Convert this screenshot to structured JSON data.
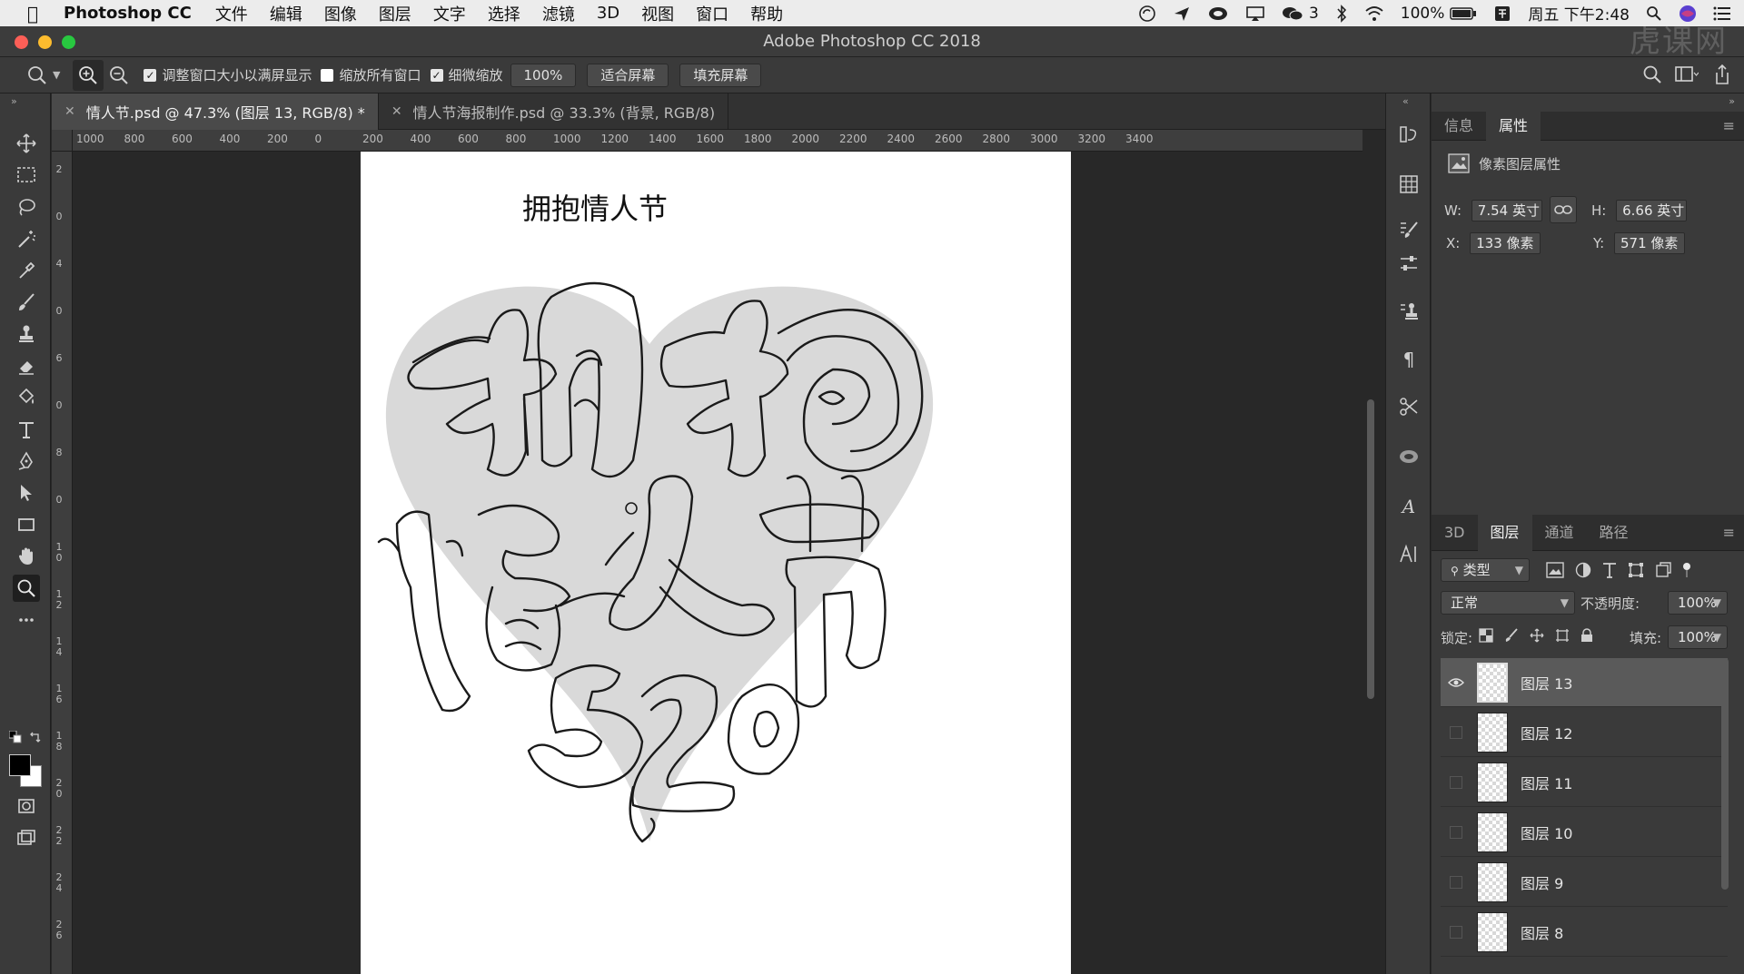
{
  "menubar": {
    "app_name": "Photoshop CC",
    "items": [
      "文件",
      "编辑",
      "图像",
      "图层",
      "文字",
      "选择",
      "滤镜",
      "3D",
      "视图",
      "窗口",
      "帮助"
    ],
    "wechat_count": "3",
    "battery": "100%",
    "clock": "周五 下午2:48"
  },
  "window": {
    "title": "Adobe Photoshop CC 2018",
    "watermark": "虎课网"
  },
  "options_bar": {
    "resize_windows_label": "调整窗口大小以满屏显示",
    "resize_windows_checked": true,
    "zoom_all_label": "缩放所有窗口",
    "zoom_all_checked": false,
    "scrubby_zoom_label": "细微缩放",
    "scrubby_zoom_checked": true,
    "zoom_value": "100%",
    "fit_screen_label": "适合屏幕",
    "fill_screen_label": "填充屏幕"
  },
  "tabs": [
    {
      "label": "情人节.psd @ 47.3% (图层 13, RGB/8) *",
      "active": true
    },
    {
      "label": "情人节海报制作.psd @ 33.3% (背景, RGB/8)",
      "active": false
    }
  ],
  "ruler": {
    "top_labels": [
      "1000",
      "800",
      "600",
      "400",
      "200",
      "0",
      "200",
      "400",
      "600",
      "800",
      "1000",
      "1200",
      "1400",
      "1600",
      "1800",
      "2000",
      "2200",
      "2400",
      "2600",
      "2800",
      "3000",
      "3200",
      "3400"
    ],
    "left_labels": [
      "2",
      "0",
      "4",
      "0",
      "6",
      "0",
      "8",
      "0",
      "1\n0",
      "1\n2",
      "1\n4",
      "1\n6",
      "1\n8",
      "2\n0",
      "2\n2",
      "2\n4",
      "2\n6"
    ]
  },
  "document": {
    "title_text": "拥抱情人节",
    "sketch_text": "拥抱情人节520"
  },
  "properties_panel": {
    "tabs": [
      "信息",
      "属性"
    ],
    "active_tab": "属性",
    "header": "像素图层属性",
    "w_label": "W:",
    "w_value": "7.54 英寸",
    "h_label": "H:",
    "h_value": "6.66 英寸",
    "x_label": "X:",
    "x_value": "133 像素",
    "y_label": "Y:",
    "y_value": "571 像素"
  },
  "layers_panel": {
    "tabs": [
      "3D",
      "图层",
      "通道",
      "路径"
    ],
    "active_tab": "图层",
    "filter_label": "类型",
    "blend_mode": "正常",
    "opacity_label": "不透明度:",
    "opacity_value": "100%",
    "lock_label": "锁定:",
    "fill_label": "填充:",
    "fill_value": "100%",
    "layers": [
      {
        "name": "图层 13",
        "visible": true,
        "selected": true
      },
      {
        "name": "图层 12",
        "visible": false,
        "selected": false
      },
      {
        "name": "图层 11",
        "visible": false,
        "selected": false
      },
      {
        "name": "图层 10",
        "visible": false,
        "selected": false
      },
      {
        "name": "图层 9",
        "visible": false,
        "selected": false
      },
      {
        "name": "图层 8",
        "visible": false,
        "selected": false
      }
    ]
  },
  "colors": {
    "heart_fill": "#d9d9d9",
    "sketch_stroke": "#1a1a1a",
    "foreground": "#000000",
    "background": "#ffffff"
  }
}
